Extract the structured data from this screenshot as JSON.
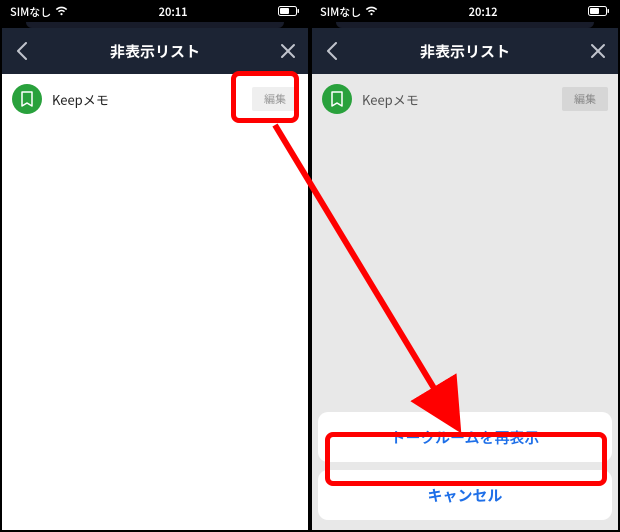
{
  "left": {
    "status": {
      "carrier": "SIMなし",
      "time": "20:11"
    },
    "nav": {
      "title": "非表示リスト"
    },
    "row": {
      "name": "Keepメモ",
      "edit": "編集"
    }
  },
  "right": {
    "status": {
      "carrier": "SIMなし",
      "time": "20:12"
    },
    "nav": {
      "title": "非表示リスト"
    },
    "row": {
      "name": "Keepメモ",
      "edit": "編集"
    },
    "sheet": {
      "primary": "トークルームを再表示",
      "cancel": "キャンセル"
    }
  },
  "colors": {
    "highlight": "#ff0000",
    "accent": "#1e6fe8",
    "avatar": "#29a13c"
  }
}
